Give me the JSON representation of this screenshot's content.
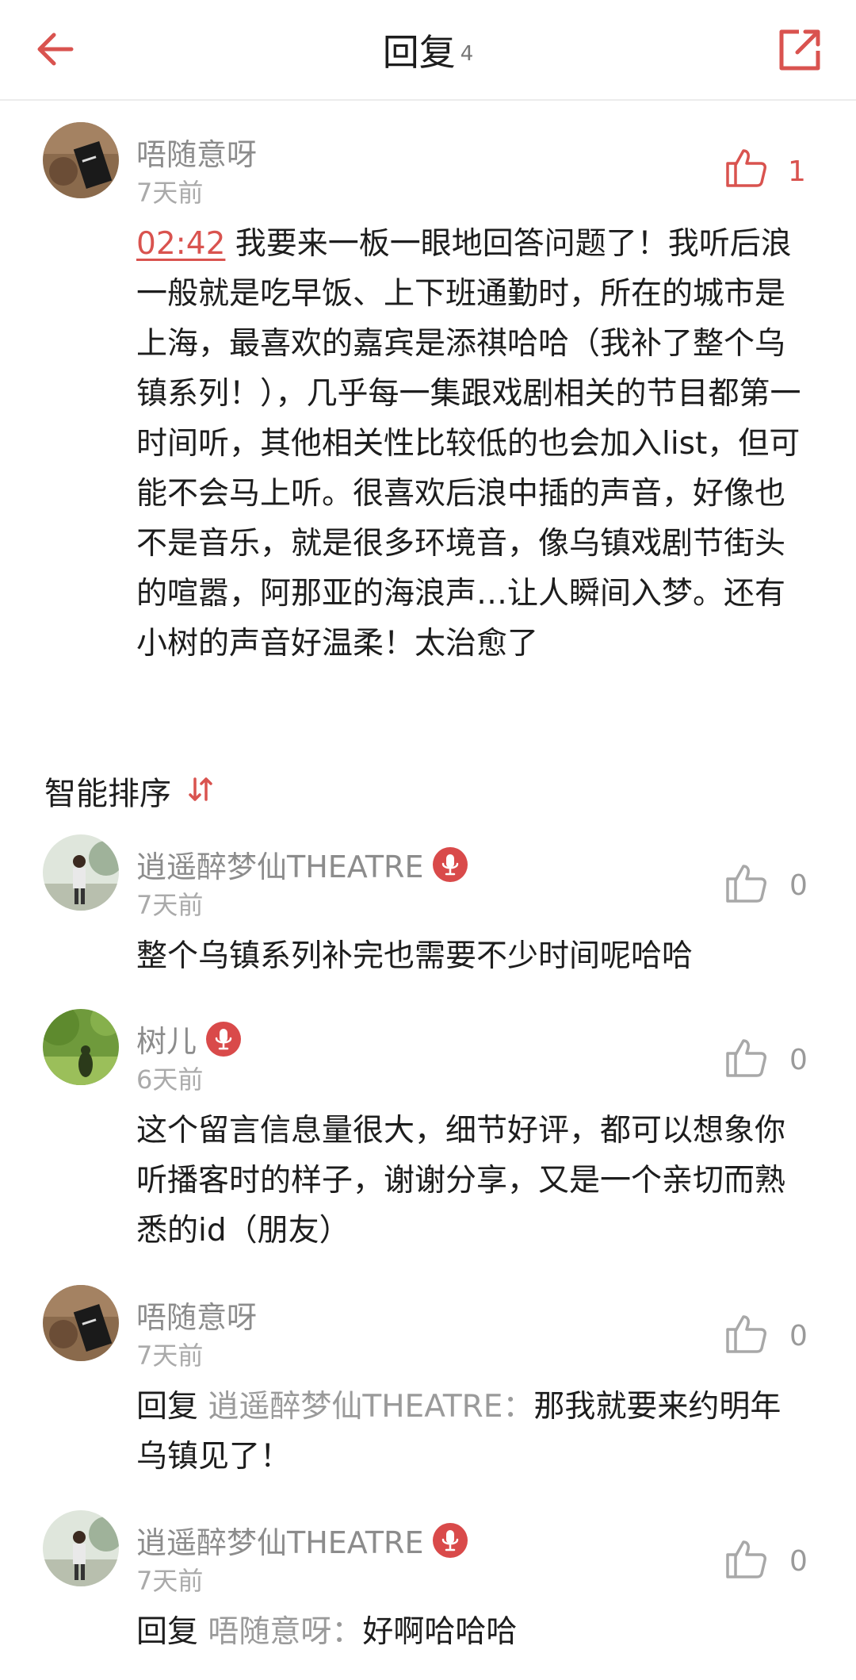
{
  "header": {
    "title": "回复",
    "count": "4"
  },
  "main_comment": {
    "username": "唔随意呀",
    "time": "7天前",
    "likes": "1",
    "timestamp": "02:42",
    "text": " 我要来一板一眼地回答问题了！我听后浪一般就是吃早饭、上下班通勤时，所在的城市是上海，最喜欢的嘉宾是添祺哈哈（我补了整个乌镇系列！），几乎每一集跟戏剧相关的节目都第一时间听，其他相关性比较低的也会加入list，但可能不会马上听。很喜欢后浪中插的声音，好像也不是音乐，就是很多环境音，像乌镇戏剧节街头的喧嚣，阿那亚的海浪声…让人瞬间入梦。还有小树的声音好温柔！太治愈了"
  },
  "sort": {
    "label": "智能排序"
  },
  "replies": [
    {
      "username": "逍遥醉梦仙THEATRE",
      "time": "7天前",
      "likes": "0",
      "text": "整个乌镇系列补完也需要不少时间呢哈哈"
    },
    {
      "username": "树儿",
      "time": "6天前",
      "likes": "0",
      "text": "这个留言信息量很大，细节好评，都可以想象你听播客时的样子，谢谢分享，又是一个亲切而熟悉的id（朋友）"
    },
    {
      "username": "唔随意呀",
      "time": "7天前",
      "likes": "0",
      "reply_prefix": "回复 ",
      "reply_target": "逍遥醉梦仙THEATRE：",
      "text": "那我就要来约明年乌镇见了！"
    },
    {
      "username": "逍遥醉梦仙THEATRE",
      "time": "7天前",
      "likes": "0",
      "reply_prefix": "回复 ",
      "reply_target": "唔随意呀：",
      "text": "好啊哈哈哈"
    }
  ],
  "colors": {
    "accent": "#d9534f",
    "mic_badge": "#d94a4a"
  }
}
